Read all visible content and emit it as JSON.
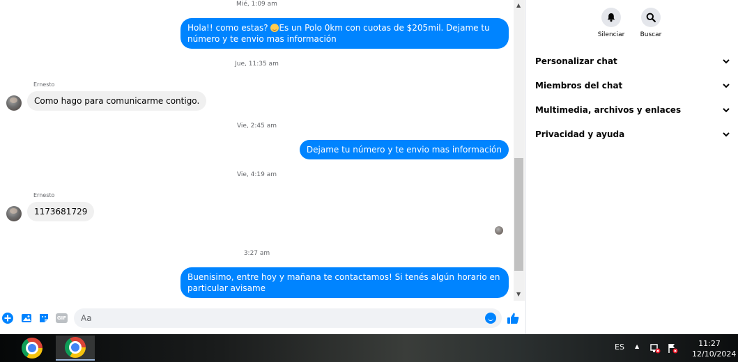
{
  "conversation": {
    "timestamps": [
      "Mié, 1:09 am",
      "Jue, 11:35 am",
      "Vie, 2:45 am",
      "Vie, 4:19 am",
      "3:27 am"
    ],
    "sender_name": "Ernesto",
    "messages": [
      {
        "text_before": "Hola!! como estas? ",
        "text_after": "Es un Polo 0km con cuotas de $205mil. Dejame tu número y te envio mas información"
      },
      {
        "text": "Como hago para comunicarme contigo."
      },
      {
        "text": "Dejame tu número y te envio mas información"
      },
      {
        "text": "1173681729"
      },
      {
        "text": "Buenisimo, entre hoy y mañana te contactamos! Si tenés algún horario en particular avisame"
      }
    ]
  },
  "composer": {
    "placeholder": "Aa",
    "gif_label": "GIF"
  },
  "panel": {
    "actions": [
      {
        "label": "Silenciar",
        "icon": "bell-icon"
      },
      {
        "label": "Buscar",
        "icon": "search-icon"
      }
    ],
    "sections": [
      {
        "label": "Personalizar chat"
      },
      {
        "label": "Miembros del chat"
      },
      {
        "label": "Multimedia, archivos y enlaces"
      },
      {
        "label": "Privacidad y ayuda"
      }
    ]
  },
  "taskbar": {
    "language": "ES",
    "time": "11:27",
    "date": "12/10/2024"
  },
  "colors": {
    "accent": "#0084ff",
    "incoming_bubble": "#f0f0f0",
    "icon_blue": "#0084ff"
  }
}
